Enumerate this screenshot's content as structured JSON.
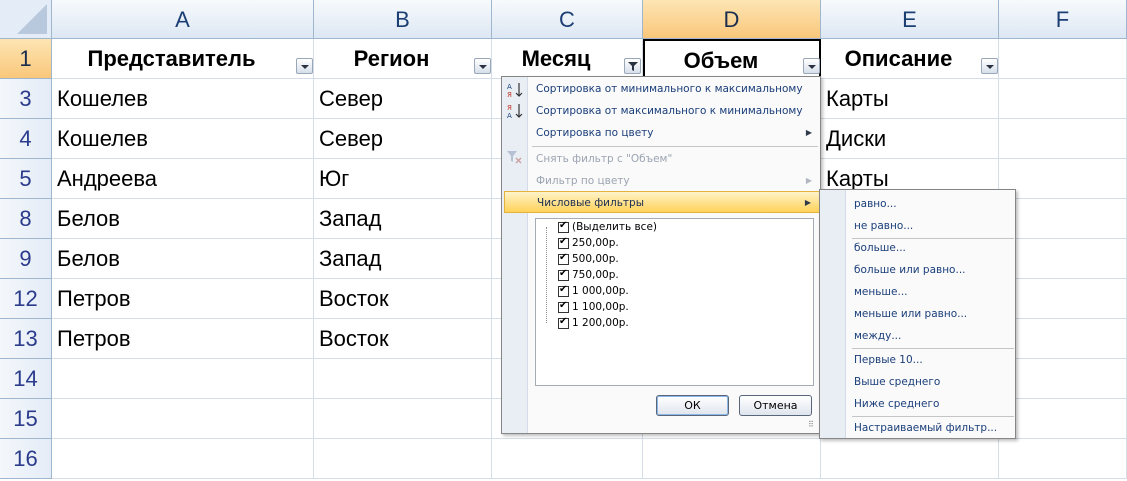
{
  "columns": [
    "A",
    "B",
    "C",
    "D",
    "E",
    "F"
  ],
  "rows": [
    "1",
    "3",
    "4",
    "5",
    "8",
    "9",
    "12",
    "13",
    "14",
    "15",
    "16"
  ],
  "headers": [
    "Представитель",
    "Регион",
    "Месяц",
    "Объем",
    "Описание"
  ],
  "data": [
    [
      "Кошелев",
      "Север",
      "",
      "",
      "Карты"
    ],
    [
      "Кошелев",
      "Север",
      "",
      "",
      "Диски"
    ],
    [
      "Андреева",
      "Юг",
      "",
      "",
      "Карты"
    ],
    [
      "Белов",
      "Запад",
      "",
      "",
      ""
    ],
    [
      "Белов",
      "Запад",
      "",
      "",
      ""
    ],
    [
      "Петров",
      "Восток",
      "",
      "",
      ""
    ],
    [
      "Петров",
      "Восток",
      "",
      "",
      ""
    ]
  ],
  "dropdown": {
    "sort_asc": "Сортировка от минимального к максимальному",
    "sort_desc": "Сортировка от максимального к минимальному",
    "sort_color": "Сортировка по цвету",
    "clear_filter": "Снять фильтр с \"Объем\"",
    "filter_color": "Фильтр по цвету",
    "number_filters": "Числовые фильтры",
    "values": [
      "(Выделить все)",
      "250,00р.",
      "500,00р.",
      "750,00р.",
      "1 000,00р.",
      "1 100,00р.",
      "1 200,00р."
    ],
    "ok": "ОК",
    "cancel": "Отмена"
  },
  "submenu": {
    "items": [
      "равно...",
      "не равно...",
      "больше...",
      "больше или равно...",
      "меньше...",
      "меньше или равно...",
      "между...",
      "Первые 10...",
      "Выше среднего",
      "Ниже среднего",
      "Настраиваемый фильтр..."
    ]
  },
  "colors": {
    "accent_highlight": "#ffd25a",
    "active_header": "#f9c77b",
    "menu_text": "#1a3e7a"
  }
}
